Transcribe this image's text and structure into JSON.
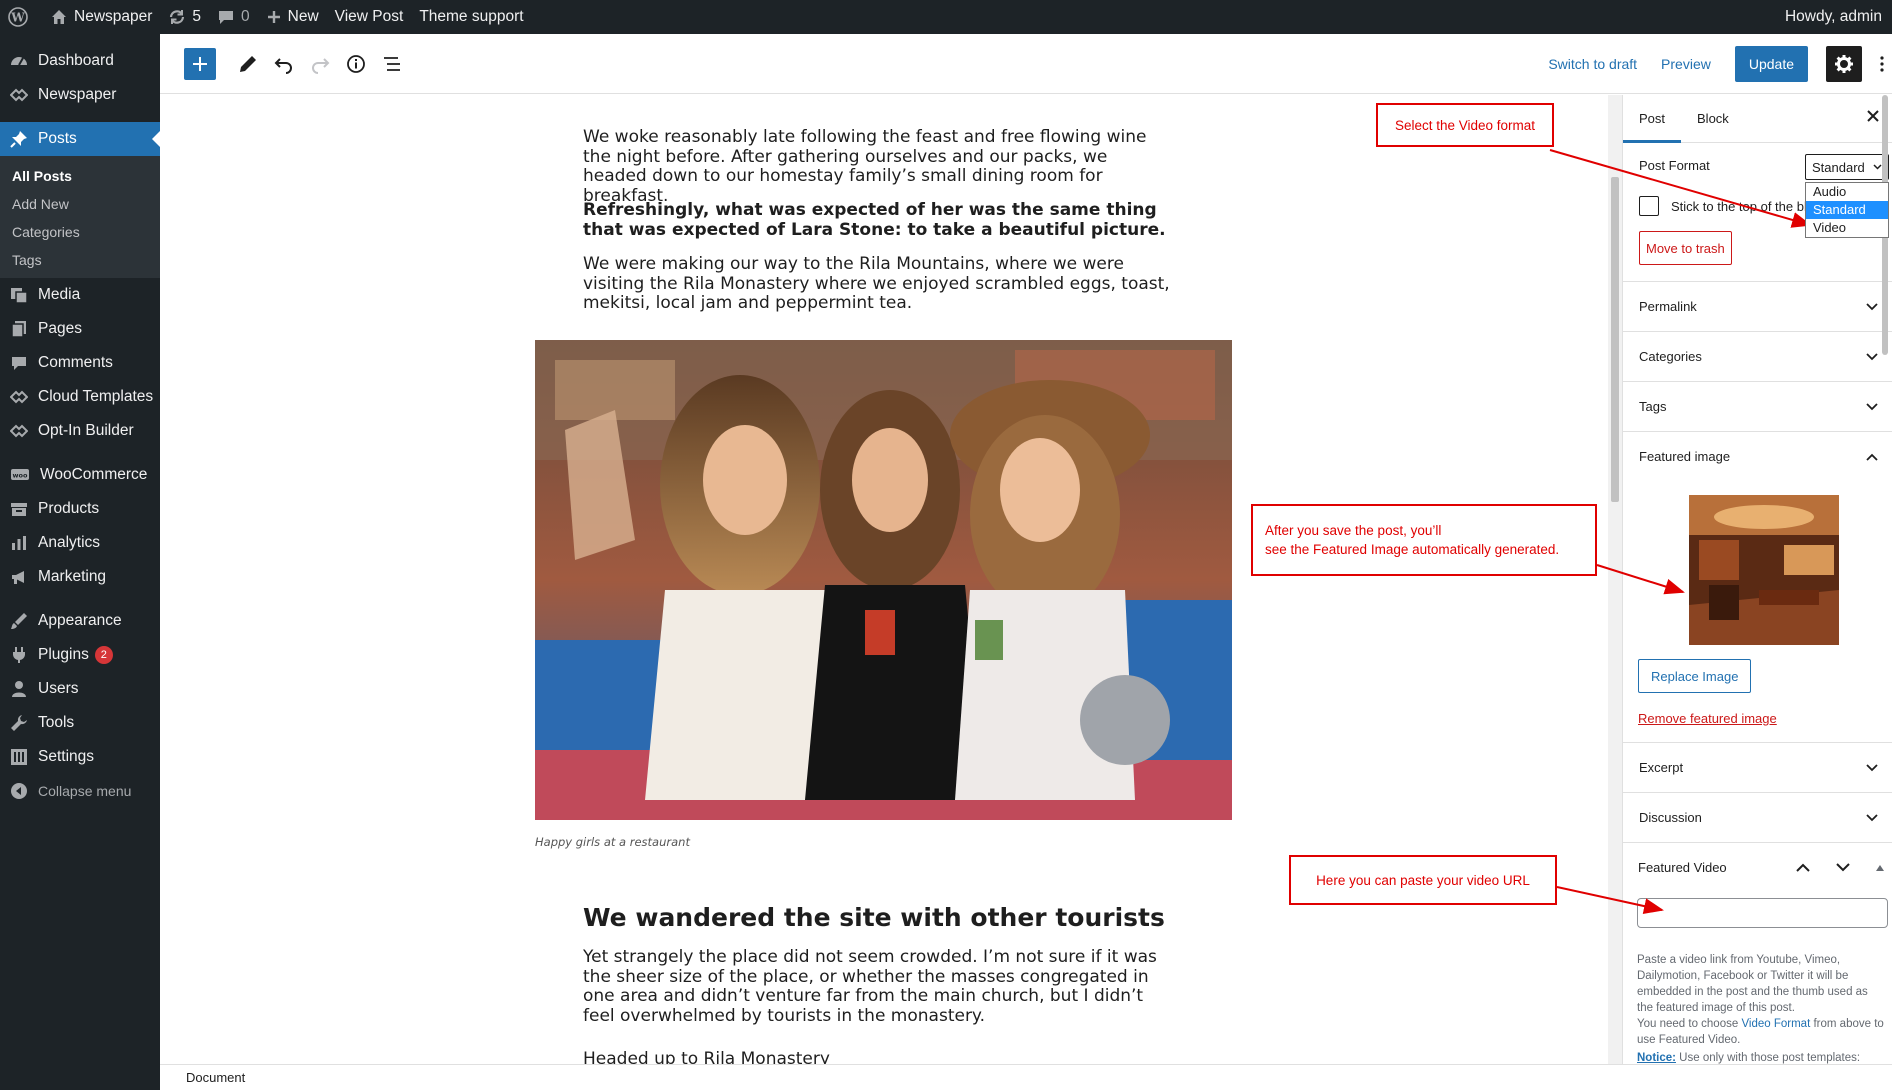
{
  "admin_bar": {
    "site_name": "Newspaper",
    "updates_count": "5",
    "comments_count": "0",
    "new_label": "New",
    "view_post_label": "View Post",
    "theme_support_label": "Theme support",
    "howdy": "Howdy, admin"
  },
  "sidebar": {
    "items": [
      {
        "label": "Dashboard",
        "icon": "dashboard-icon"
      },
      {
        "label": "Newspaper",
        "icon": "newspaper-icon"
      },
      {
        "label": "Posts",
        "icon": "pin-icon"
      },
      {
        "label": "Media",
        "icon": "media-icon"
      },
      {
        "label": "Pages",
        "icon": "pages-icon"
      },
      {
        "label": "Comments",
        "icon": "comments-icon"
      },
      {
        "label": "Cloud Templates",
        "icon": "cloud-templates-icon"
      },
      {
        "label": "Opt-In Builder",
        "icon": "optin-icon"
      },
      {
        "label": "WooCommerce",
        "icon": "woocommerce-icon"
      },
      {
        "label": "Products",
        "icon": "products-icon"
      },
      {
        "label": "Analytics",
        "icon": "analytics-icon"
      },
      {
        "label": "Marketing",
        "icon": "marketing-icon"
      },
      {
        "label": "Appearance",
        "icon": "appearance-icon"
      },
      {
        "label": "Plugins",
        "icon": "plugins-icon",
        "badge": "2"
      },
      {
        "label": "Users",
        "icon": "users-icon"
      },
      {
        "label": "Tools",
        "icon": "tools-icon"
      },
      {
        "label": "Settings",
        "icon": "settings-icon"
      }
    ],
    "posts_submenu": [
      "All Posts",
      "Add New",
      "Categories",
      "Tags"
    ],
    "collapse_label": "Collapse menu"
  },
  "editor_header": {
    "switch_to_draft": "Switch to draft",
    "preview": "Preview",
    "update": "Update"
  },
  "content": {
    "para1": "We woke reasonably late following the feast and free flowing wine the night before. After gathering ourselves and our packs, we headed down to our homestay family’s small dining room for breakfast.",
    "para2": "Refreshingly, what was expected of her was the same thing that was expected of Lara Stone: to take a beautiful picture.",
    "para3": "We were making our way to the Rila Mountains, where we were visiting the Rila Monastery where we enjoyed scrambled eggs, toast, mekitsi, local jam and peppermint tea.",
    "caption": "Happy girls at a restaurant",
    "heading": "We wandered the site with other tourists",
    "para4": "Yet strangely the place did not seem crowded. I’m not sure if it was the sheer size of the place, or whether the masses congregated in one area and didn’t venture far from the main church, but I didn’t feel overwhelmed by tourists in the monastery.",
    "para5": "Headed up to Rila Monastery"
  },
  "footer": {
    "label": "Document"
  },
  "panel": {
    "tab_post": "Post",
    "tab_block": "Block",
    "post_format_label": "Post Format",
    "post_format_value": "Standard",
    "post_format_options": [
      "Audio",
      "Standard",
      "Video"
    ],
    "stick_label": "Stick to the top of the blog",
    "move_to_trash": "Move to trash",
    "sections": {
      "permalink": "Permalink",
      "categories": "Categories",
      "tags": "Tags",
      "featured_image": "Featured image",
      "excerpt": "Excerpt",
      "discussion": "Discussion",
      "featured_video": "Featured Video"
    },
    "replace_image": "Replace Image",
    "remove_featured_image": "Remove featured image",
    "fv_help_1": "Paste a video link from Youtube, Vimeo, Dailymotion, Facebook or Twitter it will be embedded in the post and the thumb used as the featured image of this post.",
    "fv_help_2_pre": "You need to choose ",
    "fv_help_2_link": "Video Format",
    "fv_help_2_post": " from above to use Featured Video.",
    "fv_notice_label": "Notice:",
    "fv_notice_text": " Use only with those post templates:"
  },
  "annotations": {
    "select_video": "Select the Video format",
    "featured_line1": "After you save the post, you’ll",
    "featured_line2": "see the Featured Image automatically generated.",
    "paste_url": "Here you can paste your video URL"
  },
  "colors": {
    "admin_dark": "#1d2327",
    "accent": "#2271b1",
    "danger": "#cc1818",
    "annotation": "#e00000"
  }
}
